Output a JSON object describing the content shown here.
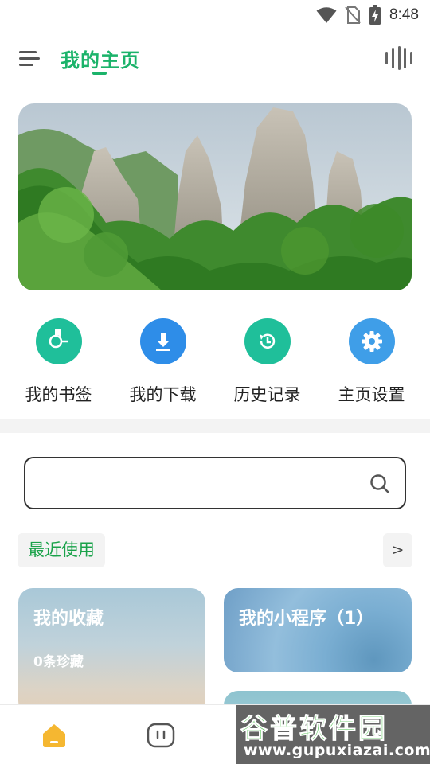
{
  "status_bar": {
    "time": "8:48",
    "icons": [
      "wifi-icon",
      "no-sim-icon",
      "battery-charging-icon"
    ]
  },
  "header": {
    "title": "我的主页",
    "menu_icon": "menu-icon",
    "voice_icon": "voice-icon",
    "accent_color": "#1bb36a"
  },
  "banner": {
    "image": "mountain-landscape"
  },
  "quick_actions": [
    {
      "label": "我的书签",
      "icon": "bookmark-icon",
      "color": "#1fbf9a"
    },
    {
      "label": "我的下载",
      "icon": "download-icon",
      "color": "#2e8de8"
    },
    {
      "label": "历史记录",
      "icon": "history-icon",
      "color": "#1fbf9a"
    },
    {
      "label": "主页设置",
      "icon": "gear-icon",
      "color": "#3f9ee8"
    }
  ],
  "search": {
    "value": "",
    "placeholder": "",
    "icon": "search-icon"
  },
  "recent": {
    "label": "最近使用",
    "more": ">"
  },
  "cards": {
    "favorites": {
      "title": "我的收藏",
      "subtitle": "0条珍藏"
    },
    "mini_programs": {
      "title": "我的小程序（1）"
    }
  },
  "bottom_nav": {
    "items": [
      "home-icon",
      "chat-icon"
    ],
    "active_color": "#f5b731"
  },
  "watermark": {
    "text": "谷普软件园",
    "url": "www.gupuxiazai.com"
  }
}
